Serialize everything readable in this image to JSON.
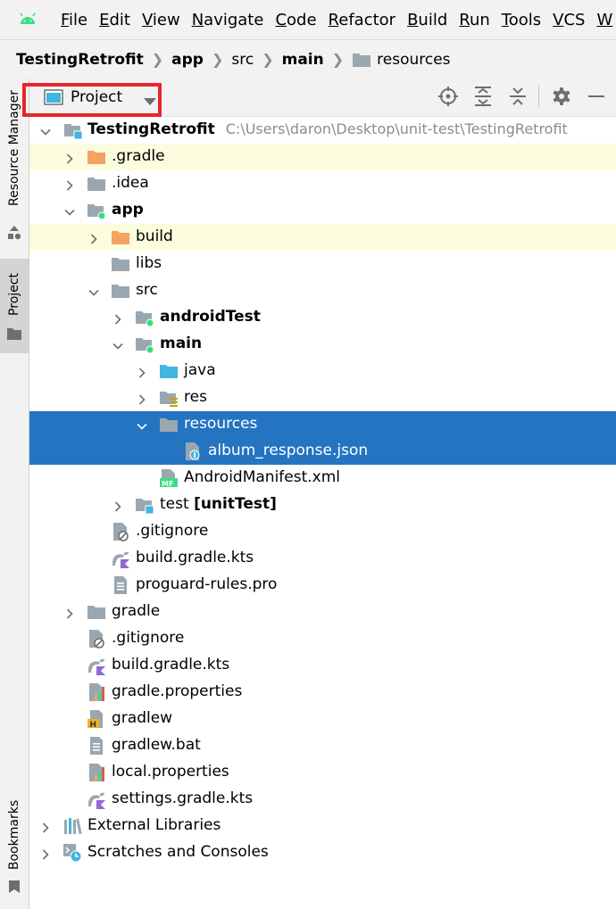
{
  "menu": [
    "File",
    "Edit",
    "View",
    "Navigate",
    "Code",
    "Refactor",
    "Build",
    "Run",
    "Tools",
    "VCS",
    "W"
  ],
  "breadcrumb": [
    {
      "label": "TestingRetrofit",
      "bold": true
    },
    {
      "label": "app",
      "bold": true
    },
    {
      "label": "src",
      "bold": false
    },
    {
      "label": "main",
      "bold": true
    },
    {
      "label": "resources",
      "bold": false
    }
  ],
  "left_strip": {
    "resource_manager": "Resource Manager",
    "project": "Project",
    "bookmarks": "Bookmarks"
  },
  "toolbar": {
    "view_label": "Project"
  },
  "tree": [
    {
      "name": "TestingRetrofit",
      "path": "C:\\Users\\daron\\Desktop\\unit-test\\TestingRetrofit",
      "bold": true,
      "icon": "module-icon"
    },
    {
      "name": ".gradle",
      "icon": "folder-orange-icon"
    },
    {
      "name": ".idea",
      "icon": "folder-icon"
    },
    {
      "name": "app",
      "bold": true,
      "icon": "android-module-icon"
    },
    {
      "name": "build",
      "icon": "folder-orange-icon"
    },
    {
      "name": "libs",
      "icon": "folder-icon"
    },
    {
      "name": "src",
      "icon": "folder-icon"
    },
    {
      "name": "androidTest",
      "bold": true,
      "icon": "source-folder-icon"
    },
    {
      "name": "main",
      "bold": true,
      "icon": "source-folder-icon"
    },
    {
      "name": "java",
      "icon": "java-folder-icon"
    },
    {
      "name": "res",
      "icon": "res-folder-icon"
    },
    {
      "name": "resources",
      "icon": "folder-icon"
    },
    {
      "name": "album_response.json",
      "icon": "json-file-icon"
    },
    {
      "name": "AndroidManifest.xml",
      "icon": "manifest-file-icon"
    },
    {
      "name": "test",
      "suffix": "[unitTest]",
      "icon": "test-folder-icon"
    },
    {
      "name": ".gitignore",
      "icon": "gitignore-file-icon"
    },
    {
      "name": "build.gradle.kts",
      "icon": "gradle-kts-icon"
    },
    {
      "name": "proguard-rules.pro",
      "icon": "text-file-icon"
    },
    {
      "name": "gradle",
      "icon": "folder-icon"
    },
    {
      "name": ".gitignore",
      "icon": "gitignore-file-icon"
    },
    {
      "name": "build.gradle.kts",
      "icon": "gradle-kts-icon"
    },
    {
      "name": "gradle.properties",
      "icon": "properties-file-icon"
    },
    {
      "name": "gradlew",
      "icon": "shell-file-icon"
    },
    {
      "name": "gradlew.bat",
      "icon": "text-file-icon"
    },
    {
      "name": "local.properties",
      "icon": "properties-file-icon"
    },
    {
      "name": "settings.gradle.kts",
      "icon": "gradle-kts-icon"
    },
    {
      "name": "External Libraries",
      "icon": "libraries-icon"
    },
    {
      "name": "Scratches and Consoles",
      "icon": "scratches-icon"
    }
  ],
  "colors": {
    "selection": "#2574c2",
    "ignored_row": "#fcfcde",
    "highlight_box": "#e5262a",
    "folder": "#9aa7b0",
    "excluded_folder": "#f4a35f"
  }
}
